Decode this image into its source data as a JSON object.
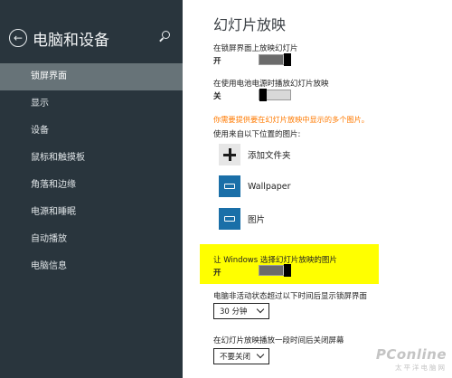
{
  "sidebar": {
    "title": "电脑和设备",
    "items": [
      {
        "label": "锁屏界面",
        "active": true
      },
      {
        "label": "显示"
      },
      {
        "label": "设备"
      },
      {
        "label": "鼠标和触摸板"
      },
      {
        "label": "角落和边缘"
      },
      {
        "label": "电源和睡眠"
      },
      {
        "label": "自动播放"
      },
      {
        "label": "电脑信息"
      }
    ]
  },
  "main": {
    "title": "幻灯片放映",
    "lock_screen_slideshow": {
      "label": "在锁屏界面上放映幻灯片",
      "state": "开",
      "on": true
    },
    "battery_slideshow": {
      "label": "在使用电池电源时播放幻灯片放映",
      "state": "关",
      "on": false
    },
    "warning": "你需要提供要在幻灯片放映中显示的多个图片。",
    "source_label": "使用来自以下位置的图片:",
    "folders": {
      "add_label": "添加文件夹",
      "items": [
        "Wallpaper",
        "图片"
      ]
    },
    "windows_choose": {
      "label": "让 Windows 选择幻灯片放映的图片",
      "state": "开",
      "on": true
    },
    "inactive_label": "电脑非活动状态超过以下时间后显示锁屏界面",
    "inactive_value": "30 分钟",
    "screen_off_label": "在幻灯片放映播放一段时间后关闭屏幕",
    "screen_off_value": "不要关闭"
  },
  "watermark": {
    "main": "PConline",
    "sub": "太平洋电脑网"
  },
  "colors": {
    "sidebar_bg": "#29353d",
    "active_item": "#677378",
    "warning": "#ff7a00",
    "highlight": "#ffff00",
    "tile": "#1a6fa8"
  }
}
